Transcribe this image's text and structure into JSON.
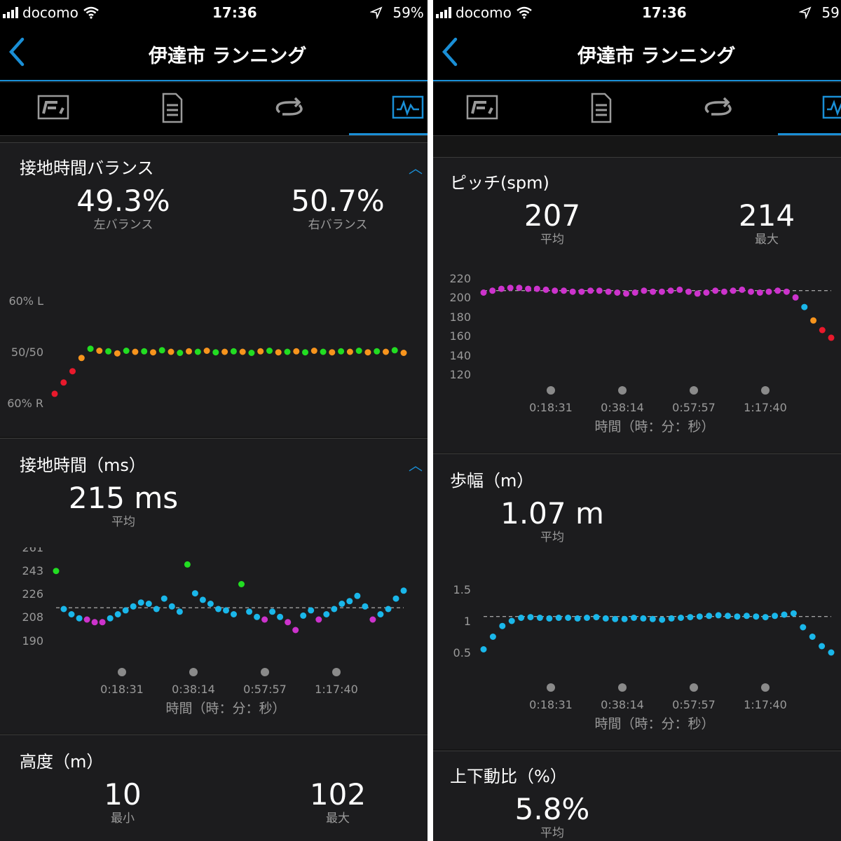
{
  "status_bar": {
    "carrier": "docomo",
    "time": "17:36",
    "battery_left": "59%",
    "battery_right": "59"
  },
  "header": {
    "title": "伊達市 ランニング"
  },
  "tabs": [
    "overview-icon",
    "details-icon",
    "laps-icon",
    "charts-icon"
  ],
  "colors": {
    "accent": "#1a8fd6",
    "green": "#22dd22",
    "orange": "#f7941d",
    "red": "#e8192c",
    "blue": "#1ab7ea",
    "magenta": "#cc33cc"
  },
  "x_axis": {
    "ticks": [
      "0:18:31",
      "0:38:14",
      "0:57:57",
      "1:17:40"
    ],
    "label": "時間（時：分：秒）"
  },
  "left": {
    "gct_balance": {
      "title": "接地時間バランス",
      "left_value": "49.3%",
      "left_label": "左バランス",
      "right_value": "50.7%",
      "right_label": "右バランス",
      "y_ticks": [
        "60% L",
        "50/50",
        "60% R"
      ]
    },
    "gct": {
      "title": "接地時間（ms）",
      "value": "215 ms",
      "label": "平均",
      "y_ticks": [
        "261",
        "243",
        "226",
        "208",
        "190"
      ]
    },
    "elevation": {
      "title": "高度（m）",
      "min_value": "10",
      "min_label": "最小",
      "max_value": "102",
      "max_label": "最大"
    }
  },
  "right": {
    "cadence": {
      "title": "ピッチ(spm)",
      "avg_value": "207",
      "avg_label": "平均",
      "max_value": "214",
      "max_label": "最大",
      "y_ticks": [
        "220",
        "200",
        "180",
        "160",
        "140",
        "120"
      ]
    },
    "stride": {
      "title": "歩幅（m）",
      "value": "1.07 m",
      "label": "平均",
      "y_ticks": [
        "1.5",
        "1",
        "0.5"
      ]
    },
    "vertical_ratio": {
      "title": "上下動比（%）",
      "value": "5.8%",
      "label": "平均"
    }
  },
  "chart_data": [
    {
      "type": "scatter",
      "title": "接地時間バランス",
      "y_ticks": [
        "60% L",
        "50/50",
        "60% R"
      ],
      "ylim": [
        -10,
        10
      ],
      "x_ticks": [
        "0:18:31",
        "0:38:14",
        "0:57:57",
        "1:17:40"
      ],
      "xlabel": "時間（時：分：秒）",
      "reference": 0,
      "mean_left_pct": 49.3,
      "series": [
        {
          "values": [
            -8.2,
            -6.0,
            -3.8,
            -1.2,
            0.6,
            0.2,
            0.1,
            -0.3,
            0.2,
            0.0,
            0.1,
            -0.1,
            0.3,
            0.0,
            -0.2,
            0.1,
            0.0,
            0.2,
            -0.1,
            0.0,
            0.1,
            0.0,
            -0.2,
            0.1,
            0.2,
            -0.1,
            0.0,
            0.1,
            -0.1,
            0.2,
            0.0,
            -0.1,
            0.1,
            0.0,
            0.2,
            -0.1,
            0.1,
            0.0,
            0.3,
            -0.2
          ]
        }
      ]
    },
    {
      "type": "scatter",
      "title": "接地時間（ms）",
      "ylim": [
        190,
        261
      ],
      "y_ticks": [
        261,
        243,
        226,
        208,
        190
      ],
      "x_ticks": [
        "0:18:31",
        "0:38:14",
        "0:57:57",
        "1:17:40"
      ],
      "xlabel": "時間（時：分：秒）",
      "mean": 215,
      "series": [
        {
          "values": [
            243,
            214,
            210,
            207,
            206,
            204,
            204,
            207,
            210,
            213,
            216,
            219,
            218,
            214,
            222,
            216,
            212,
            248,
            226,
            221,
            218,
            214,
            213,
            210,
            233,
            212,
            208,
            206,
            212,
            208,
            204,
            198,
            209,
            213,
            206,
            210,
            214,
            218,
            220,
            224,
            216,
            206,
            210,
            214,
            222,
            228
          ]
        }
      ]
    },
    {
      "type": "scatter",
      "title": "ピッチ(spm)",
      "ylim": [
        120,
        220
      ],
      "y_ticks": [
        220,
        200,
        180,
        160,
        140,
        120
      ],
      "x_ticks": [
        "0:18:31",
        "0:38:14",
        "0:57:57",
        "1:17:40"
      ],
      "xlabel": "時間（時：分：秒）",
      "mean": 207,
      "max": 214,
      "series": [
        {
          "values": [
            205,
            207,
            209,
            210,
            210,
            209,
            209,
            208,
            207,
            207,
            206,
            206,
            207,
            207,
            206,
            205,
            204,
            205,
            207,
            206,
            206,
            207,
            208,
            206,
            204,
            205,
            207,
            206,
            207,
            208,
            206,
            205,
            206,
            207,
            206,
            200,
            190,
            176,
            166,
            158
          ]
        }
      ]
    },
    {
      "type": "scatter",
      "title": "歩幅（m）",
      "ylim": [
        0.4,
        1.6
      ],
      "y_ticks": [
        1.5,
        1,
        0.5
      ],
      "x_ticks": [
        "0:18:31",
        "0:38:14",
        "0:57:57",
        "1:17:40"
      ],
      "xlabel": "時間（時：分：秒）",
      "mean": 1.07,
      "series": [
        {
          "values": [
            0.55,
            0.75,
            0.92,
            1.0,
            1.05,
            1.06,
            1.05,
            1.04,
            1.05,
            1.05,
            1.04,
            1.05,
            1.06,
            1.04,
            1.03,
            1.03,
            1.05,
            1.04,
            1.03,
            1.02,
            1.04,
            1.05,
            1.06,
            1.07,
            1.08,
            1.09,
            1.08,
            1.07,
            1.08,
            1.07,
            1.06,
            1.08,
            1.1,
            1.12,
            0.9,
            0.75,
            0.6,
            0.5
          ]
        }
      ]
    }
  ]
}
